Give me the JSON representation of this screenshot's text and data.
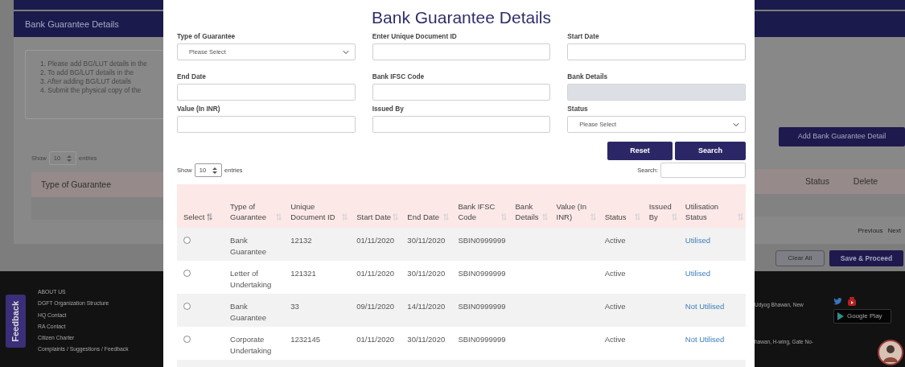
{
  "background_page": {
    "left": {
      "section_title": "Bank Guarantee Details",
      "instructions": [
        "1. Please add BG/LUT details in the",
        "2. To add BG/LUT details in the",
        "3. After adding BG/LUT details",
        "4. Submit the physical copy of the"
      ],
      "show_label": "Show",
      "page_length": "10",
      "entries_label": "entries",
      "table_column": "Type of Guarantee",
      "feedback_tab": "Feedback",
      "footer_links": [
        "ABOUT US",
        "DGFT Organization Structure",
        "HQ Contact",
        "RA Contact",
        "Citizen Charter",
        "Complaints / Suggestions / Feedback"
      ]
    },
    "right": {
      "add_button": "Add Bank Guarantee Detail",
      "table_columns": [
        "Status",
        "Delete"
      ],
      "pagination": [
        "Previous",
        "Next"
      ],
      "clear_button": "Clear All",
      "save_button": "Save & Proceed",
      "address_lines": [
        "Udyog Bhawan, New",
        "hawan, H-wing, Gate No-"
      ],
      "store_badge": "Google Play"
    }
  },
  "modal": {
    "title": "Bank Guarantee Details",
    "fields": [
      {
        "label": "Type of Guarantee",
        "kind": "select",
        "value": "Please Select",
        "disabled": false
      },
      {
        "label": "Enter Unique Document ID",
        "kind": "text",
        "disabled": false
      },
      {
        "label": "Start Date",
        "kind": "text",
        "disabled": false
      },
      {
        "label": "End Date",
        "kind": "text",
        "disabled": false
      },
      {
        "label": "Bank IFSC Code",
        "kind": "text",
        "disabled": false
      },
      {
        "label": "Bank Details",
        "kind": "text",
        "disabled": true
      },
      {
        "label": "Value (In INR)",
        "kind": "text",
        "disabled": false
      },
      {
        "label": "Issued By",
        "kind": "text",
        "disabled": false
      },
      {
        "label": "Status",
        "kind": "select",
        "value": "Please Select",
        "disabled": false
      }
    ],
    "buttons": [
      "Reset",
      "Search"
    ],
    "show_label": "Show",
    "page_length": "10",
    "entries_label": "entries",
    "search_label": "Search:",
    "table": {
      "columns": [
        "Select",
        "Type of Guarantee",
        "Unique Document ID",
        "Start Date",
        "End Date",
        "Bank IFSC Code",
        "Bank Details",
        "Value (In INR)",
        "Status",
        "Issued By",
        "Utilisation Status"
      ],
      "rows": [
        {
          "selected": false,
          "type": "Bank Guarantee",
          "document_id": "12132",
          "start_date": "01/11/2020",
          "end_date": "30/11/2020",
          "ifsc": "SBIN0999999",
          "status": "Active",
          "utilisation": "Utilised"
        },
        {
          "selected": false,
          "type": "Letter of Undertaking",
          "document_id": "121321",
          "start_date": "01/11/2020",
          "end_date": "30/11/2020",
          "ifsc": "SBIN0999999",
          "status": "Active",
          "utilisation": "Utilised"
        },
        {
          "selected": false,
          "type": "Bank Guarantee",
          "document_id": "33",
          "start_date": "09/11/2020",
          "end_date": "14/11/2020",
          "ifsc": "SBIN0999999",
          "status": "Active",
          "utilisation": "Not Utilised"
        },
        {
          "selected": false,
          "type": "Corporate Undertaking",
          "document_id": "1232145",
          "start_date": "01/11/2020",
          "end_date": "30/11/2020",
          "ifsc": "SBIN0999999",
          "status": "Active",
          "utilisation": "Not Utilised"
        }
      ]
    }
  }
}
